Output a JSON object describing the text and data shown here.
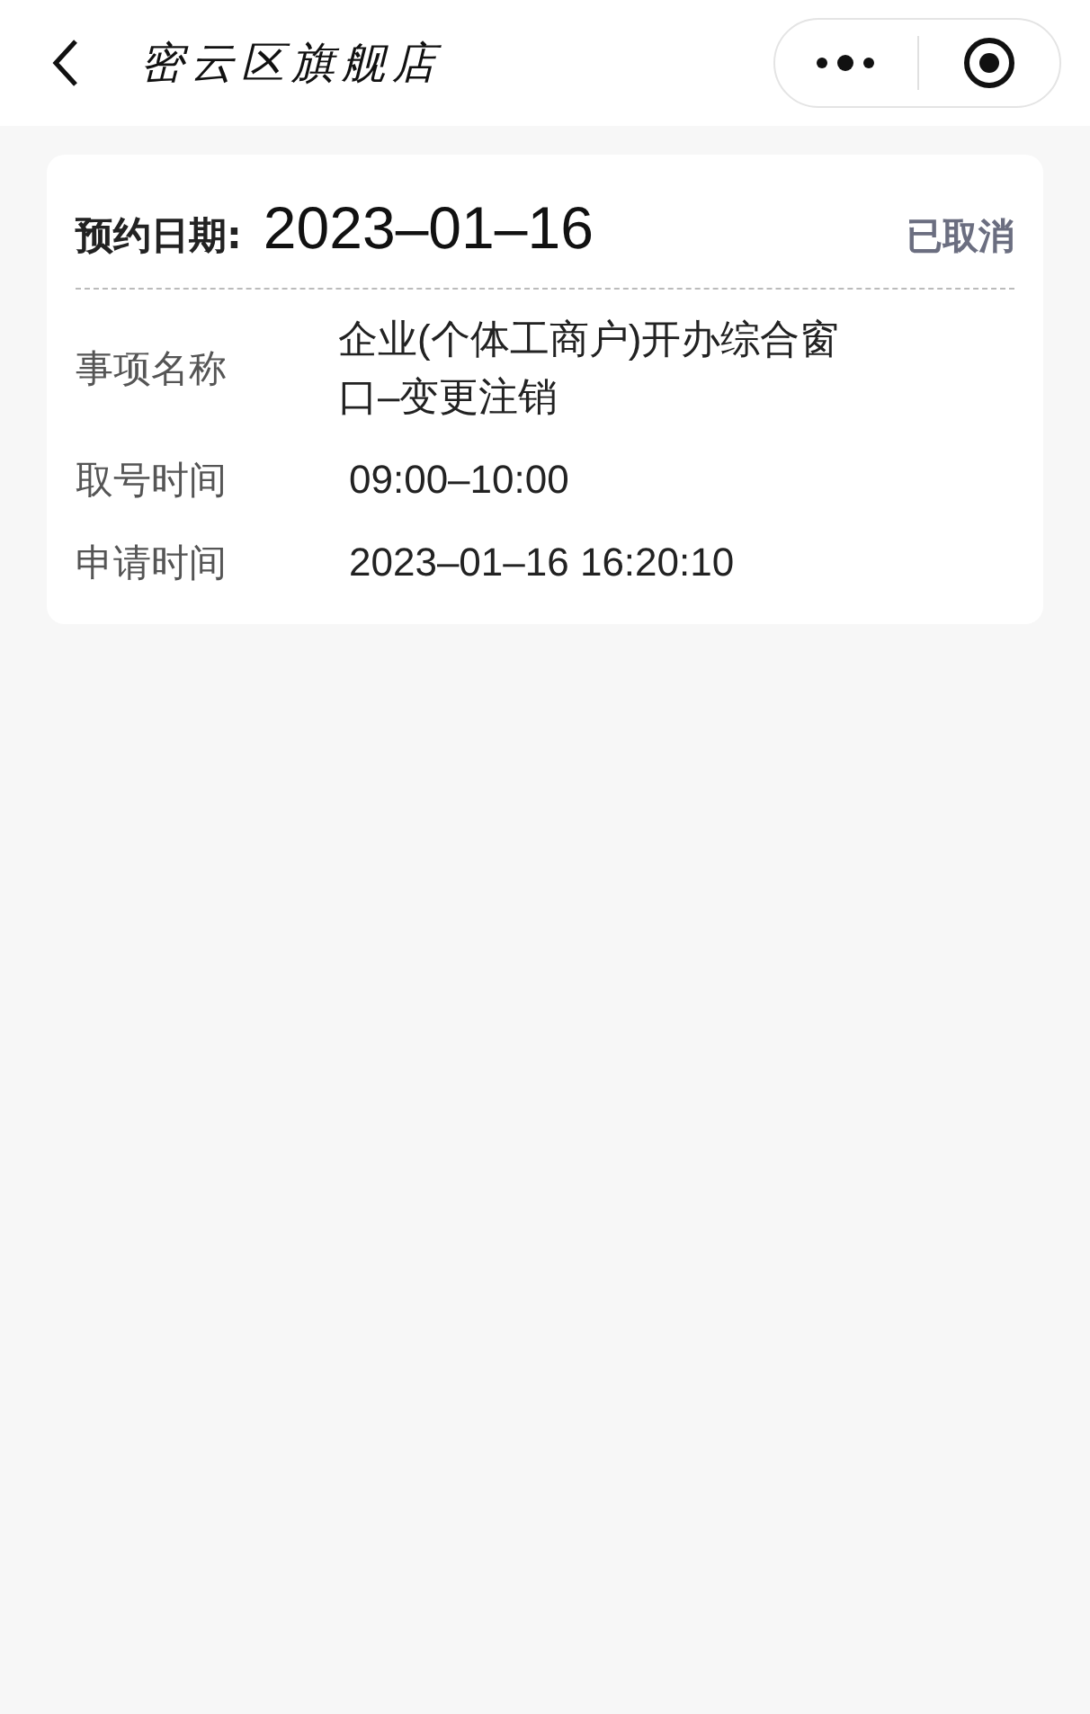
{
  "header": {
    "title": "密云区旗舰店"
  },
  "appointment": {
    "date_label": "预约日期:",
    "date": "2023–01–16",
    "status": "已取消",
    "fields": [
      {
        "label": "事项名称",
        "value": "企业(个体工商户)开办综合窗口–变更注销"
      },
      {
        "label": "取号时间",
        "value": "09:00–10:00"
      },
      {
        "label": "申请时间",
        "value": "2023–01–16 16:20:10"
      }
    ]
  }
}
